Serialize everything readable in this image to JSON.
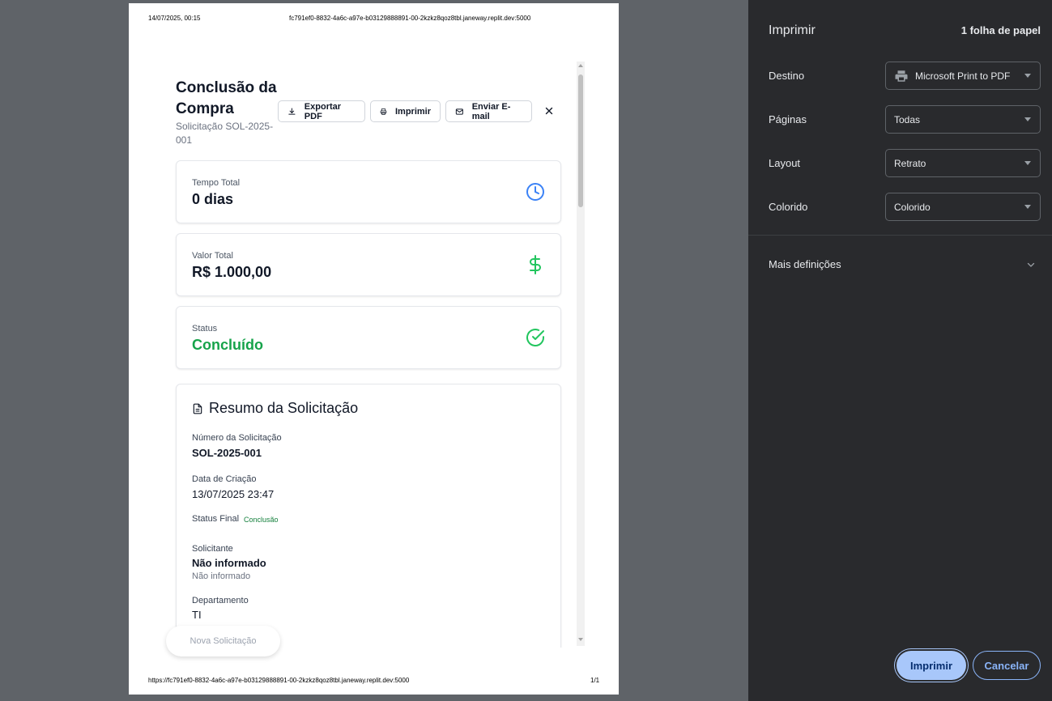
{
  "page_header": {
    "date": "14/07/2025, 00:15",
    "url": "fc791ef0-8832-4a6c-a97e-b03129888891-00-2kzkz8qoz8tbl.janeway.replit.dev:5000"
  },
  "page_footer": {
    "url": "https://fc791ef0-8832-4a6c-a97e-b03129888891-00-2kzkz8qoz8tbl.janeway.replit.dev:5000",
    "page": "1/1"
  },
  "modal": {
    "title": "Conclusão da Compra",
    "subtitle": "Solicitação SOL-2025-001",
    "buttons": {
      "export_pdf": "Exportar PDF",
      "print": "Imprimir",
      "email": "Enviar E-mail"
    },
    "cards": [
      {
        "label": "Tempo Total",
        "value": "0 dias",
        "icon": "clock-icon"
      },
      {
        "label": "Valor Total",
        "value": "R$ 1.000,00",
        "icon": "dollar-icon"
      },
      {
        "label": "Status",
        "value": "Concluído",
        "icon": "check-circle-icon"
      }
    ],
    "summary": {
      "title": "Resumo da Solicitação",
      "request_number_label": "Número da Solicitação",
      "request_number": "SOL-2025-001",
      "created_label": "Data de Criação",
      "created": "13/07/2025 23:47",
      "final_status_label": "Status Final",
      "final_status": "Conclusão",
      "requester_label": "Solicitante",
      "requester": "Não informado",
      "requester_sub": "Não informado",
      "department_label": "Departamento",
      "department": "TI"
    },
    "floating_button": "Nova Solicitação"
  },
  "print_panel": {
    "title": "Imprimir",
    "sheets": "1 folha de papel",
    "destination_label": "Destino",
    "destination": "Microsoft Print to PDF",
    "pages_label": "Páginas",
    "pages": "Todas",
    "layout_label": "Layout",
    "layout": "Retrato",
    "color_label": "Colorido",
    "color": "Colorido",
    "more_settings": "Mais definições",
    "print_button": "Imprimir",
    "cancel_button": "Cancelar",
    "accent_color": "#a8c7fa"
  }
}
